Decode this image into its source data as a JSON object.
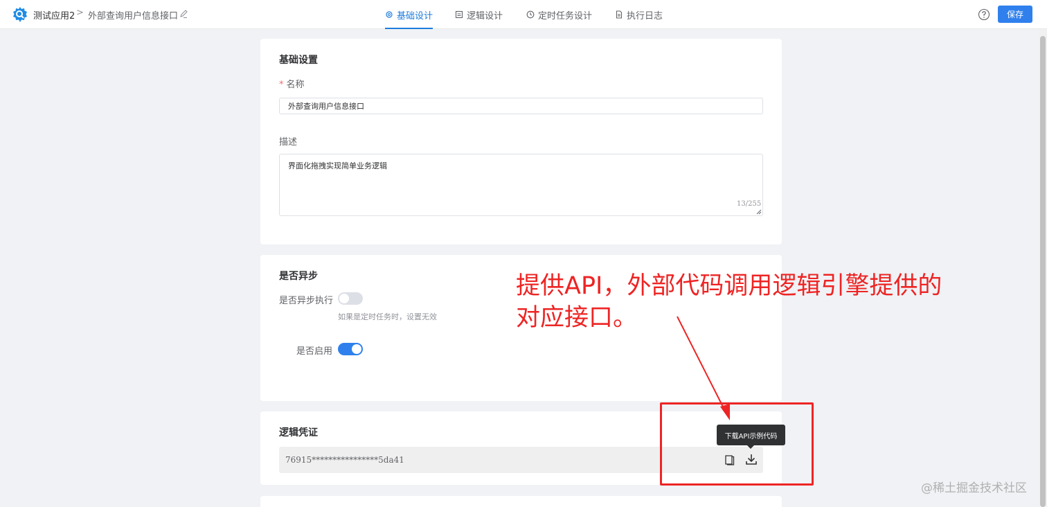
{
  "header": {
    "app_name": "测试应用2",
    "breadcrumb_separator": ">",
    "page_name": "外部查询用户信息接口",
    "save_label": "保存",
    "tabs": [
      {
        "label": "基础设计",
        "icon": "gear-icon",
        "active": true
      },
      {
        "label": "逻辑设计",
        "icon": "layout-icon",
        "active": false
      },
      {
        "label": "定时任务设计",
        "icon": "clock-icon",
        "active": false
      },
      {
        "label": "执行日志",
        "icon": "document-icon",
        "active": false
      }
    ],
    "accent_color": "#2f80ed"
  },
  "basic": {
    "title": "基础设置",
    "required_mark": "*",
    "name_label": "名称",
    "name_value": "外部查询用户信息接口",
    "desc_label": "描述",
    "desc_value": "界面化拖拽实现简单业务逻辑",
    "desc_count": "13/255"
  },
  "async": {
    "title": "是否异步",
    "async_label": "是否异步执行",
    "async_on": false,
    "async_hint": "如果是定时任务时，设置无效",
    "enabled_label": "是否启用",
    "enabled_on": true
  },
  "credential": {
    "title": "逻辑凭证",
    "value": "76915****************5da41",
    "tooltip": "下载API示例代码"
  },
  "annotation": {
    "text": "提供API，外部代码调用逻辑引擎提供的对应接口。",
    "color": "#ee2424"
  },
  "watermark": "@稀土掘金技术社区"
}
